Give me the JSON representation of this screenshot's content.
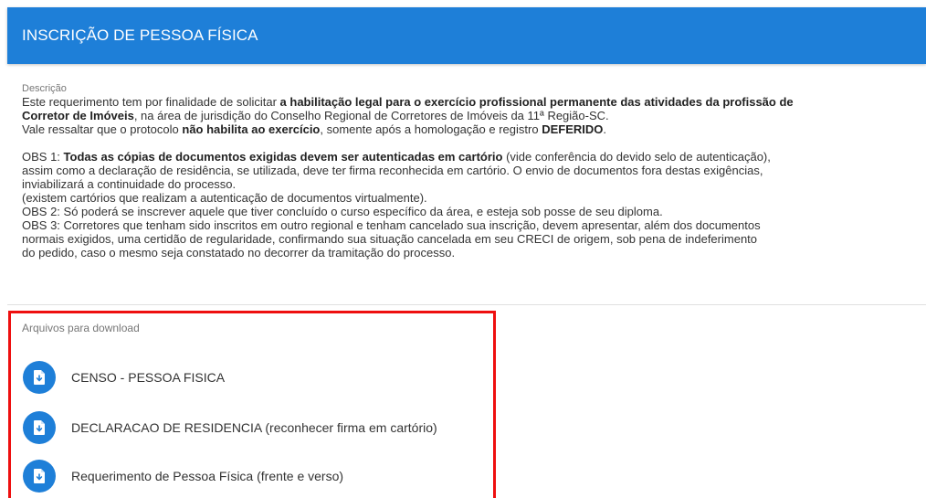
{
  "header": {
    "title": "INSCRIÇÃO DE PESSOA FÍSICA"
  },
  "description": {
    "label": "Descrição",
    "p1_a": "Este requerimento tem por finalidade de solicitar ",
    "p1_b": "a habilitação legal para o exercício profissional permanente das atividades da profissão de",
    "p1_c": "Corretor de Imóveis",
    "p1_d": ", na área de jurisdição do Conselho Regional de Corretores de Imóveis da 11ª Região-SC.",
    "p2_a": "Vale ressaltar que o protocolo ",
    "p2_b": "não habilita ao exercício",
    "p2_c": ", somente após a homologação e registro ",
    "p2_d": "DEFERIDO",
    "p2_e": ".",
    "obs1_a": "OBS 1: ",
    "obs1_b": "Todas as cópias de documentos exigidas devem ser autenticadas em cartório",
    "obs1_c": " (vide conferência do devido selo de autenticação),",
    "obs1_line2": "assim como a declaração de residência, se utilizada, deve ter firma reconhecida em cartório. O envio de documentos fora destas exigências,",
    "obs1_line3": "inviabilizará a continuidade do processo.",
    "obs1_line4": "(existem cartórios que realizam a autenticação de documentos virtualmente).",
    "obs2": "OBS 2: Só poderá se inscrever aquele que tiver concluído o curso específico da área, e esteja sob posse de seu diploma.",
    "obs3_line1": "OBS 3: Corretores que tenham sido inscritos em outro regional e tenham cancelado sua inscrição, devem apresentar, além dos documentos",
    "obs3_line2": "normais exigidos, uma certidão de regularidade, confirmando sua situação cancelada em seu CRECI de origem, sob pena de indeferimento",
    "obs3_line3": "do pedido, caso o mesmo seja constatado no decorrer da tramitação do processo."
  },
  "downloads": {
    "label": "Arquivos para download",
    "icon": "file-download-icon",
    "accent_color": "#1e7fd8",
    "highlight_color": "#ee0f0f",
    "items": [
      {
        "label": "CENSO - PESSOA FISICA"
      },
      {
        "label": "DECLARACAO DE RESIDENCIA (reconhecer firma em cartório)"
      },
      {
        "label": "Requerimento de Pessoa Física (frente e verso)"
      }
    ]
  }
}
